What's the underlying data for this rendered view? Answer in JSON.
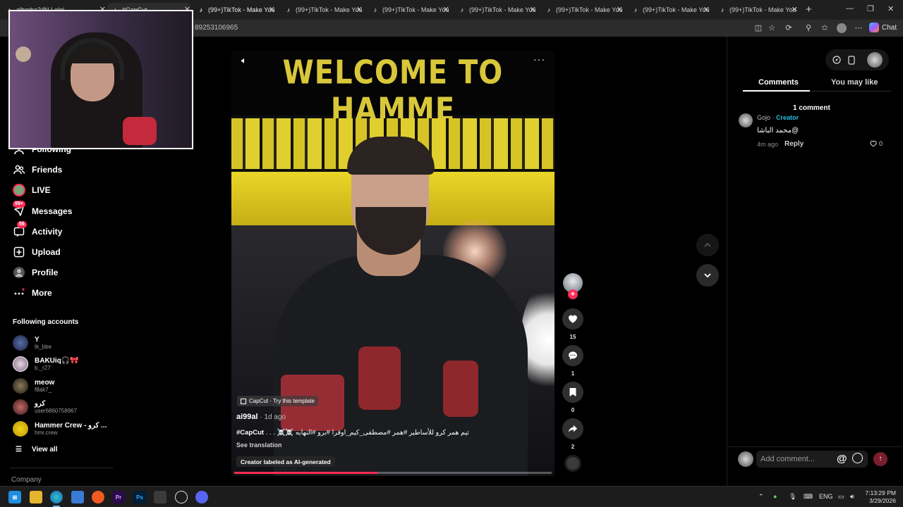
{
  "browser": {
    "tabs": [
      {
        "title": "alhorba2@LLolol",
        "active": false
      },
      {
        "title": "#CapCut",
        "active": true
      },
      {
        "title": "(99+)TikTok - Make You",
        "active": false
      },
      {
        "title": "(99+)TikTok - Make You",
        "active": false
      },
      {
        "title": "(99+)TikTok - Make You",
        "active": false
      },
      {
        "title": "(99+)TikTok - Make You",
        "active": false
      },
      {
        "title": "(99+)TikTok - Make You",
        "active": false
      },
      {
        "title": "(99+)TikTok - Make You",
        "active": false
      },
      {
        "title": "(99+)TikTok - Make You",
        "active": false
      }
    ],
    "url": "89253106965",
    "chat_label": "Chat"
  },
  "sidebar": {
    "nav": [
      {
        "label": "Following",
        "icon": "following-icon"
      },
      {
        "label": "Friends",
        "icon": "friends-icon"
      },
      {
        "label": "LIVE",
        "icon": "live-icon"
      },
      {
        "label": "Messages",
        "icon": "messages-icon",
        "badge": "99+"
      },
      {
        "label": "Activity",
        "icon": "activity-icon",
        "badge": "56"
      },
      {
        "label": "Upload",
        "icon": "upload-icon"
      },
      {
        "label": "Profile",
        "icon": "profile-icon"
      },
      {
        "label": "More",
        "icon": "more-icon"
      }
    ],
    "following_title": "Following accounts",
    "accounts": [
      {
        "name": "Y",
        "handle": "tk_bbe"
      },
      {
        "name": "BAKUiq🎧🎀",
        "handle": "b._r27"
      },
      {
        "name": "meow",
        "handle": "f8ak7_"
      },
      {
        "name": "كرو",
        "handle": "user6860758967"
      },
      {
        "name": "Hammer Crew - كرو ...",
        "handle": "hmr.crew"
      }
    ],
    "view_all": "View all",
    "company": "Company"
  },
  "video": {
    "title_overlay": "WELCOME TO HAMME",
    "capcut_badge": "CapCut · Try this template",
    "author": "ai99al",
    "date": " · 1d ago",
    "caption_tag": "#CapCut",
    "caption_text": " . . . ☠️☠️ تيم همر كرو للأساطير #همر #مصطفى_كيم_اوفرا #برو #النهايه",
    "see_translation": "See translation",
    "ai_label": "Creator labeled as AI-generated",
    "progress": 0.45
  },
  "actions": {
    "likes": "15",
    "comments": "1",
    "saves": "0",
    "shares": "2"
  },
  "comments_panel": {
    "tabs": [
      "Comments",
      "You may like"
    ],
    "count_label": "1 comment",
    "comments": [
      {
        "user": "Gojo",
        "creator_label": "Creator",
        "text": "محمد الباشا@",
        "time": "4m ago",
        "reply": "Reply",
        "likes": "0"
      }
    ],
    "input_placeholder": "Add comment..."
  },
  "taskbar": {
    "lang": "ENG",
    "time": "7:13:29 PM",
    "date": "3/29/2026"
  },
  "colors": {
    "accent": "#fe2c55",
    "creator": "#25c0e0",
    "bg": "#000000"
  }
}
